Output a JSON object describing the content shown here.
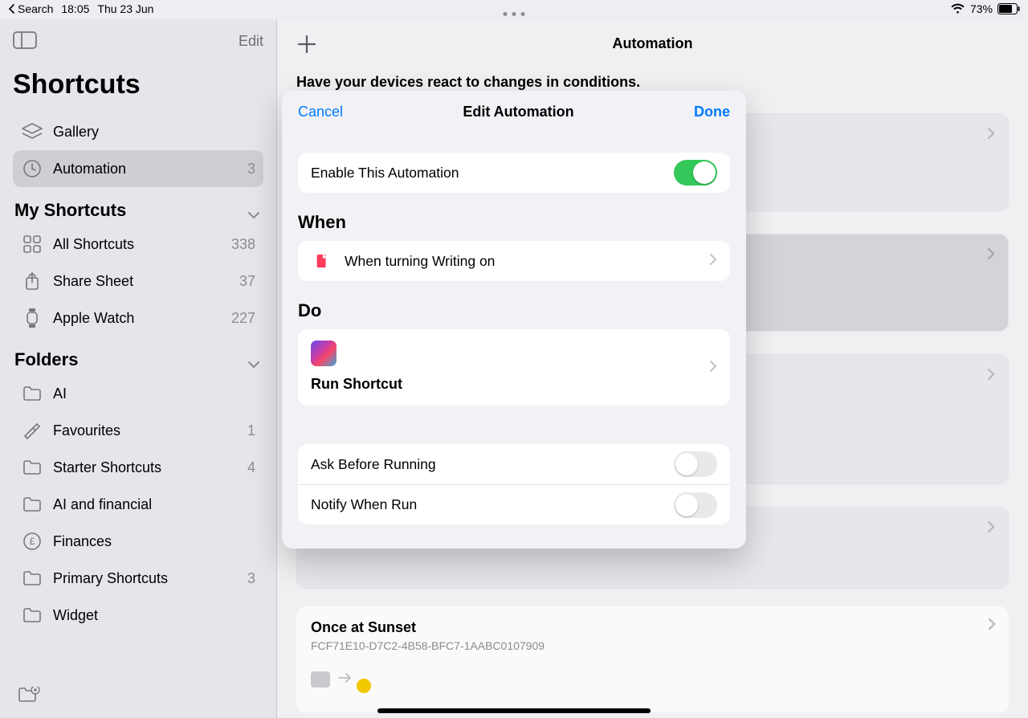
{
  "status": {
    "back_label": "Search",
    "time": "18:05",
    "date": "Thu 23 Jun",
    "battery": "73%"
  },
  "sidebar": {
    "edit": "Edit",
    "title": "Shortcuts",
    "nav": [
      {
        "label": "Gallery"
      },
      {
        "label": "Automation",
        "count": "3"
      }
    ],
    "section_my": "My Shortcuts",
    "my": [
      {
        "label": "All Shortcuts",
        "count": "338"
      },
      {
        "label": "Share Sheet",
        "count": "37"
      },
      {
        "label": "Apple Watch",
        "count": "227"
      }
    ],
    "section_folders": "Folders",
    "folders": [
      {
        "label": "AI",
        "count": ""
      },
      {
        "label": "Favourites",
        "count": "1"
      },
      {
        "label": "Starter Shortcuts",
        "count": "4"
      },
      {
        "label": "AI and financial",
        "count": ""
      },
      {
        "label": "Finances",
        "count": ""
      },
      {
        "label": "Primary Shortcuts",
        "count": "3"
      },
      {
        "label": "Widget",
        "count": ""
      }
    ]
  },
  "main": {
    "title": "Automation",
    "subtitle": "Have your devices react to changes in conditions.",
    "last_card": {
      "title": "Once at Sunset",
      "sub": "FCF71E10-D7C2-4B58-BFC7-1AABC0107909"
    }
  },
  "modal": {
    "cancel": "Cancel",
    "title": "Edit Automation",
    "done": "Done",
    "enable_label": "Enable This Automation",
    "when_title": "When",
    "when_row": "When turning Writing on",
    "do_title": "Do",
    "do_row": "Run Shortcut",
    "ask_label": "Ask Before Running",
    "notify_label": "Notify When Run"
  }
}
